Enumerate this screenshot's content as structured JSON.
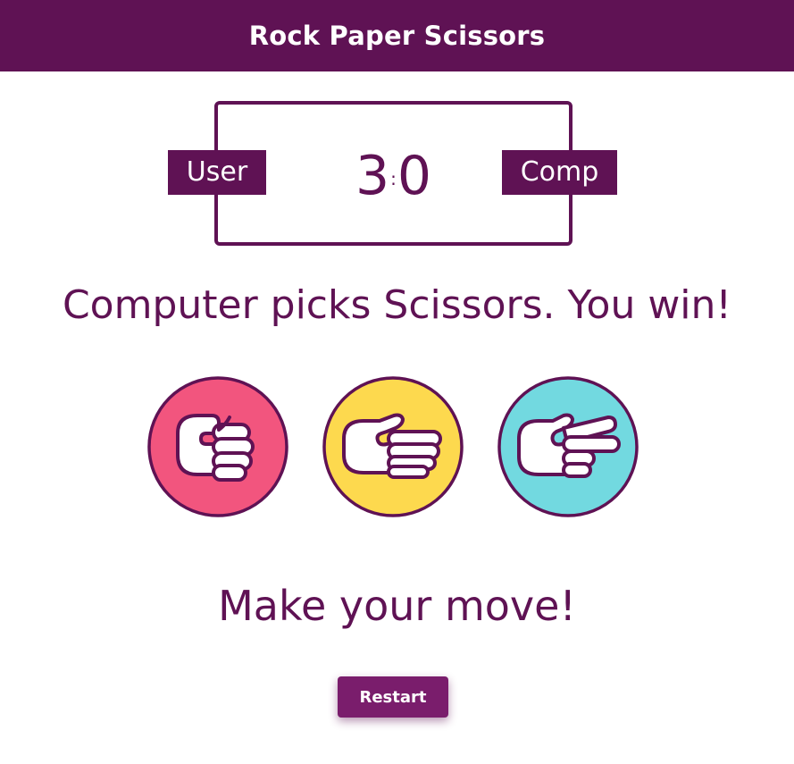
{
  "header": {
    "title": "Rock Paper Scissors"
  },
  "scoreboard": {
    "user_label": "User",
    "comp_label": "Comp",
    "user_score": "3",
    "separator": ":",
    "comp_score": "0"
  },
  "result_message": "Computer picks Scissors. You win!",
  "choices": [
    {
      "name": "rock",
      "icon": "rock-hand-icon",
      "color": "#f2557e"
    },
    {
      "name": "paper",
      "icon": "paper-hand-icon",
      "color": "#fdd94e"
    },
    {
      "name": "scissors",
      "icon": "scissors-hand-icon",
      "color": "#72d9e0"
    }
  ],
  "prompt": "Make your move!",
  "restart_label": "Restart",
  "colors": {
    "primary": "#5f1254",
    "button": "#7a1d6c",
    "background": "#ffffff"
  }
}
